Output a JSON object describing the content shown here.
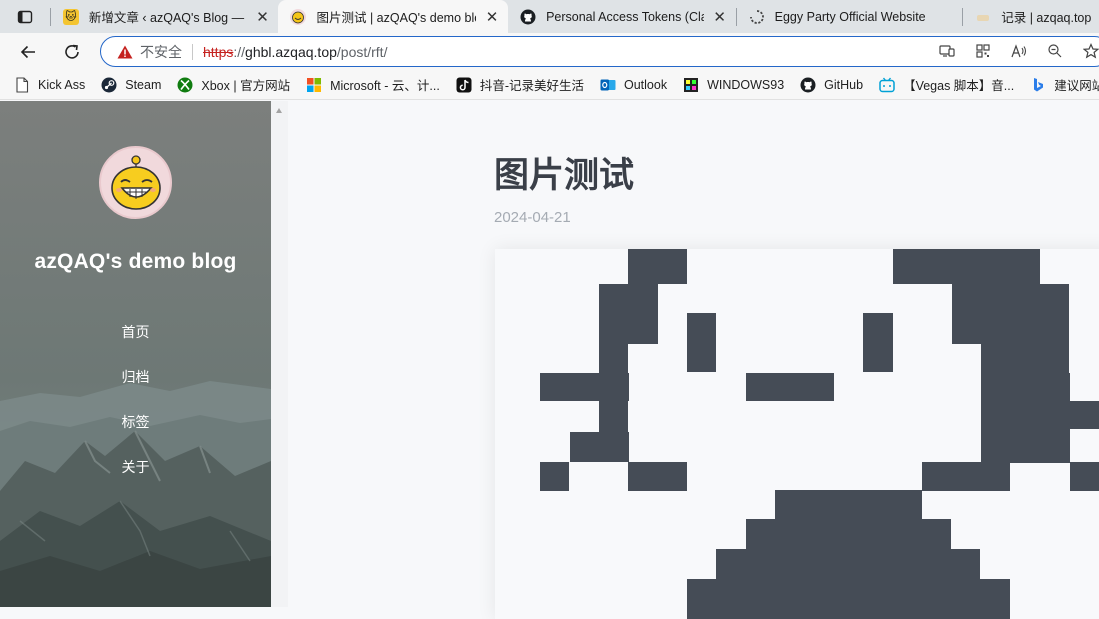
{
  "browser": {
    "tabs": [
      {
        "title": "新增文章 ‹ azQAQ's Blog — W",
        "favicon": "cat-icon",
        "active": false
      },
      {
        "title": "图片测试 | azQAQ's demo blo",
        "favicon": "smiley-avatar-icon",
        "active": true
      },
      {
        "title": "Personal Access Tokens (Class",
        "favicon": "github-icon",
        "active": false
      },
      {
        "title": "Eggy Party Official Website",
        "favicon": "loading-spinner-icon",
        "active": false
      },
      {
        "title": "记录 | azqaq.top |",
        "favicon": "page-icon",
        "active": false
      }
    ],
    "address": {
      "warning_label": "不安全",
      "url_scheme": "https",
      "url_sep": "://",
      "url_host": "ghbl.azqaq.top",
      "url_path": "/post/rft/"
    },
    "bookmarks": [
      {
        "label": "Kick Ass",
        "icon": "document-icon"
      },
      {
        "label": "Steam",
        "icon": "steam-icon"
      },
      {
        "label": "Xbox | 官方网站",
        "icon": "xbox-icon"
      },
      {
        "label": "Microsoft - 云、计...",
        "icon": "microsoft-icon"
      },
      {
        "label": "抖音-记录美好生活",
        "icon": "douyin-icon"
      },
      {
        "label": "Outlook",
        "icon": "outlook-icon"
      },
      {
        "label": "WINDOWS93",
        "icon": "windows93-icon"
      },
      {
        "label": "GitHub",
        "icon": "github-icon"
      },
      {
        "label": "【Vegas 脚本】音...",
        "icon": "bilibili-icon"
      },
      {
        "label": "建议网站",
        "icon": "bing-icon"
      }
    ]
  },
  "blog": {
    "site_title": "azQAQ's demo blog",
    "nav": [
      "首页",
      "归档",
      "标签",
      "关于"
    ]
  },
  "post": {
    "title": "图片测试",
    "date": "2024-04-21"
  },
  "colors": {
    "accent": "#2467c9",
    "pixel_dark": "#454c56",
    "pixel_light": "#f8f9fb"
  }
}
